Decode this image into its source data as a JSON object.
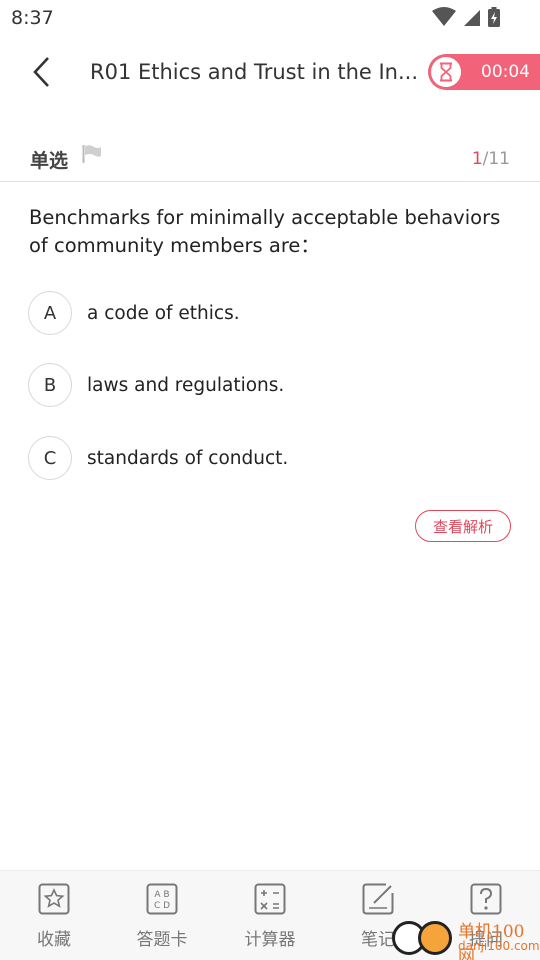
{
  "status_bar": {
    "time": "8:37"
  },
  "header": {
    "title": "R01 Ethics and Trust in the In...",
    "timer": "00:04"
  },
  "question": {
    "type": "单选",
    "current": "1",
    "total": "/11",
    "text": "Benchmarks for minimally acceptable behaviors of community members are：",
    "options": [
      {
        "letter": "A",
        "text": "a code of ethics."
      },
      {
        "letter": "B",
        "text": "laws and regulations."
      },
      {
        "letter": "C",
        "text": "standards of conduct."
      }
    ],
    "analysis_label": "查看解析"
  },
  "bottom_tabs": [
    {
      "label": "收藏",
      "icon": "star-icon"
    },
    {
      "label": "答题卡",
      "icon": "answer-card-icon"
    },
    {
      "label": "计算器",
      "icon": "calculator-icon"
    },
    {
      "label": "笔记",
      "icon": "note-icon"
    },
    {
      "label": "提问",
      "icon": "question-icon"
    }
  ],
  "watermark": {
    "text": "单机100网",
    "sub": "danji100.com"
  },
  "colors": {
    "accent": "#e0485c",
    "timer_bg": "#f2637a"
  }
}
